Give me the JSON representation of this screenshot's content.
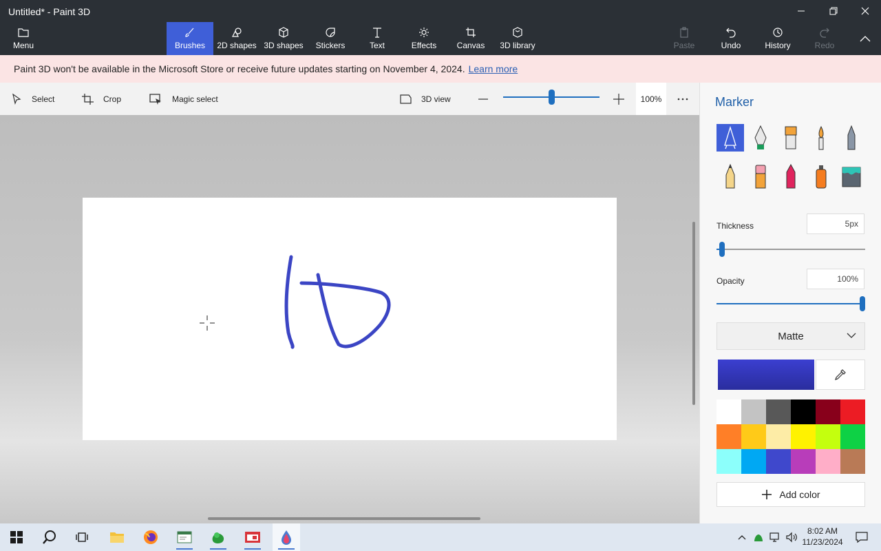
{
  "window": {
    "title": "Untitled* - Paint 3D"
  },
  "menu": {
    "label": "Menu"
  },
  "tools": [
    {
      "label": "Brushes",
      "icon": "brush-icon",
      "active": true
    },
    {
      "label": "2D shapes",
      "icon": "2d-shapes-icon"
    },
    {
      "label": "3D shapes",
      "icon": "3d-shapes-icon"
    },
    {
      "label": "Stickers",
      "icon": "stickers-icon"
    },
    {
      "label": "Text",
      "icon": "text-icon"
    },
    {
      "label": "Effects",
      "icon": "effects-icon"
    },
    {
      "label": "Canvas",
      "icon": "canvas-icon"
    },
    {
      "label": "3D library",
      "icon": "3d-library-icon"
    }
  ],
  "actions": [
    {
      "label": "Paste",
      "icon": "paste-icon",
      "disabled": true
    },
    {
      "label": "Undo",
      "icon": "undo-icon"
    },
    {
      "label": "History",
      "icon": "history-icon"
    },
    {
      "label": "Redo",
      "icon": "redo-icon",
      "disabled": true
    }
  ],
  "banner": {
    "text": "Paint 3D won't be available in the Microsoft Store or receive future updates starting on November 4, 2024.",
    "link": "Learn more"
  },
  "toolbar": {
    "select": "Select",
    "crop": "Crop",
    "magic_select": "Magic select",
    "view3d": "3D view",
    "zoom": "100%",
    "zoom_level": 0.5
  },
  "panel": {
    "title": "Marker",
    "brushes": [
      "marker-icon",
      "calligraphy-pen-icon",
      "oil-brush-icon",
      "watercolor-icon",
      "pixel-pen-icon",
      "pencil-icon",
      "eraser-icon",
      "crayon-icon",
      "spray-can-icon",
      "fill-icon"
    ],
    "thickness_label": "Thickness",
    "thickness_value": "5px",
    "thickness_level": 0.02,
    "opacity_label": "Opacity",
    "opacity_value": "100%",
    "opacity_level": 1.0,
    "finish": "Matte",
    "current_color": "#3b3fd0",
    "palette": [
      "#ffffff",
      "#c3c3c3",
      "#585858",
      "#000000",
      "#88001b",
      "#ec1c24",
      "#ff7f27",
      "#ffca18",
      "#fdeca6",
      "#fff200",
      "#c4ff0e",
      "#0ed145",
      "#8cfffb",
      "#00a8f3",
      "#3f48cc",
      "#b83dba",
      "#ffaec8",
      "#b97a56"
    ],
    "add_color": "Add color"
  },
  "taskbar": {
    "time": "8:02 AM",
    "date": "11/23/2024"
  },
  "colors": {
    "accent": "#3f5fd8",
    "stroke": "#3b45c4"
  }
}
